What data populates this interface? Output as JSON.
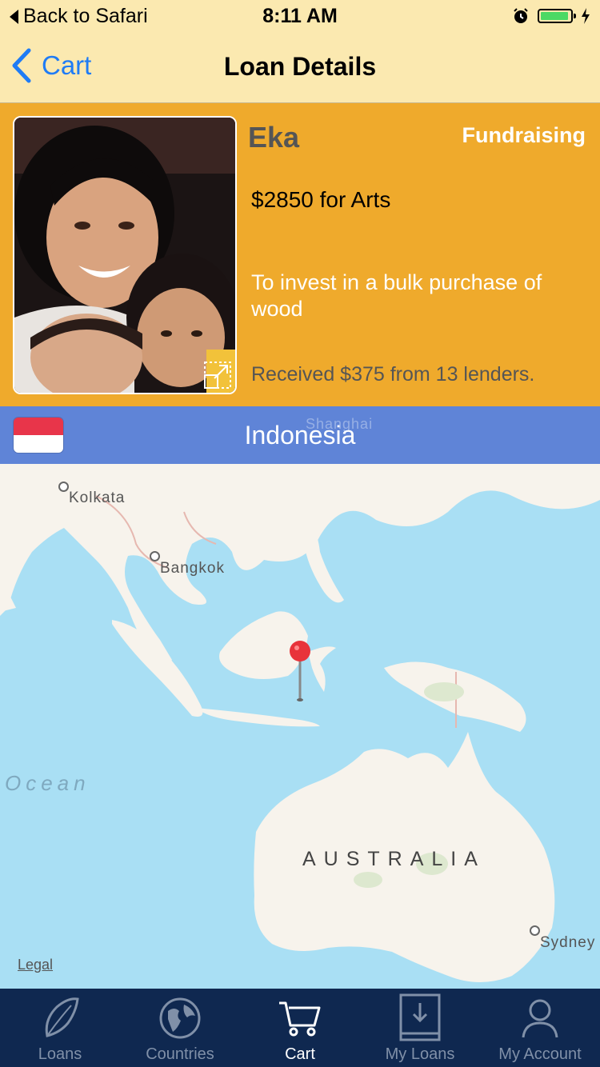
{
  "status_bar": {
    "back_label": "Back to Safari",
    "time": "8:11 AM",
    "battery_level": 0.95
  },
  "nav": {
    "back_label": "Cart",
    "title": "Loan Details"
  },
  "loan": {
    "name": "Eka",
    "status": "Fundraising",
    "amount": "$2850 for Arts",
    "use": "To invest in a bulk purchase of wood",
    "received": "Received $375 from 13 lenders."
  },
  "country": {
    "name": "Indonesia",
    "flag_colors": [
      "#e8354a",
      "#ffffff"
    ],
    "ghost_city": "Shanghai"
  },
  "map": {
    "cities": [
      "Kolkata",
      "Bangkok",
      "Sydney"
    ],
    "ocean_label": "Ocean",
    "continent_label": "AUSTRALIA",
    "legal": "Legal",
    "pin_color": "#e8333a"
  },
  "tabs": [
    {
      "label": "Loans",
      "icon": "leaf-icon",
      "active": false
    },
    {
      "label": "Countries",
      "icon": "globe-icon",
      "active": false
    },
    {
      "label": "Cart",
      "icon": "cart-icon",
      "active": true
    },
    {
      "label": "My Loans",
      "icon": "book-icon",
      "active": false
    },
    {
      "label": "My Account",
      "icon": "person-icon",
      "active": false
    }
  ],
  "colors": {
    "status_bg": "#fbe9b0",
    "loan_bg": "#efaa2c",
    "country_bar": "#5f84d7",
    "tab_bg": "#0f2850",
    "link": "#1f7cf5"
  }
}
